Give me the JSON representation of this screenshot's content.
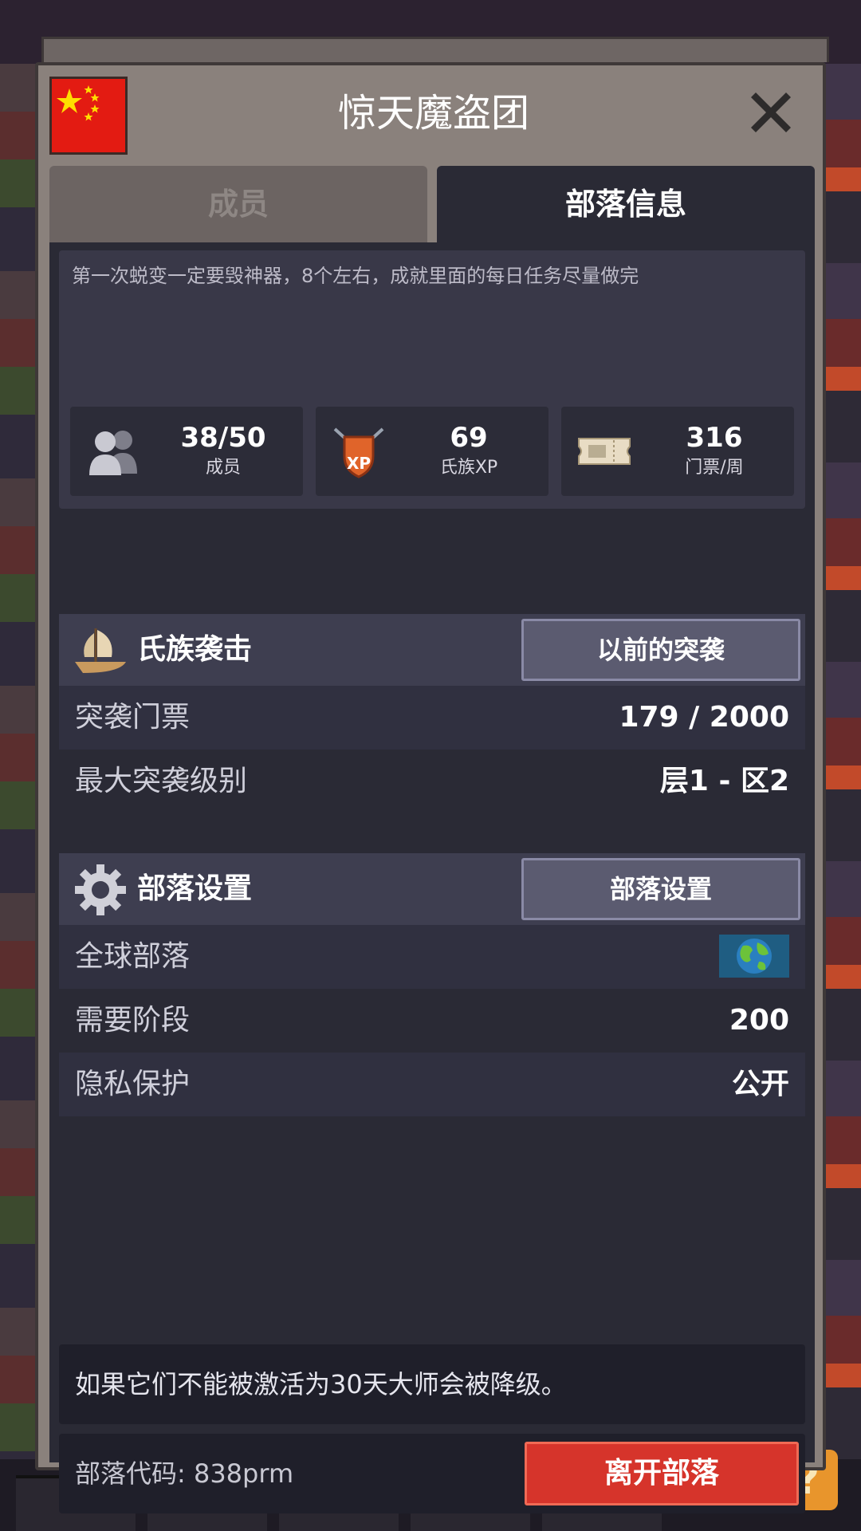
{
  "header": {
    "title": "惊天魔盗团",
    "flag_color": "#e31b12",
    "flag_icon": "china-flag-icon",
    "close_icon": "close-x-icon"
  },
  "tabs": [
    {
      "label": "成员",
      "active": false
    },
    {
      "label": "部落信息",
      "active": true
    }
  ],
  "description": "第一次蜕变一定要毁神器，8个左右，成就里面的每日任务尽量做完",
  "stats": [
    {
      "icon": "members-icon",
      "value": "38/50",
      "label": "成员"
    },
    {
      "icon": "clan-xp-shield-icon",
      "value": "69",
      "label": "氏族XP",
      "icon_text": "XP"
    },
    {
      "icon": "ticket-icon",
      "value": "316",
      "label": "门票/周"
    }
  ],
  "raid": {
    "icon": "ship-icon",
    "title": "氏族袭击",
    "button_label": "以前的突袭",
    "rows": [
      {
        "label": "突袭门票",
        "value": "179 / 2000"
      },
      {
        "label": "最大突袭级别",
        "value": "层1 - 区2"
      }
    ]
  },
  "settings": {
    "icon": "gear-icon",
    "title": "部落设置",
    "button_label": "部落设置",
    "rows": [
      {
        "label": "全球部落",
        "value_icon": "globe-icon"
      },
      {
        "label": "需要阶段",
        "value": "200"
      },
      {
        "label": "隐私保护",
        "value": "公开"
      }
    ]
  },
  "notice": "如果它们不能被激活为30天大师会被降级。",
  "footer": {
    "code_text": "部落代码: 838prm",
    "leave_button": "离开部落"
  },
  "help_button": "?",
  "colors": {
    "panel": "#2a2a35",
    "frame": "#8a817c",
    "leave": "#d6342b"
  }
}
